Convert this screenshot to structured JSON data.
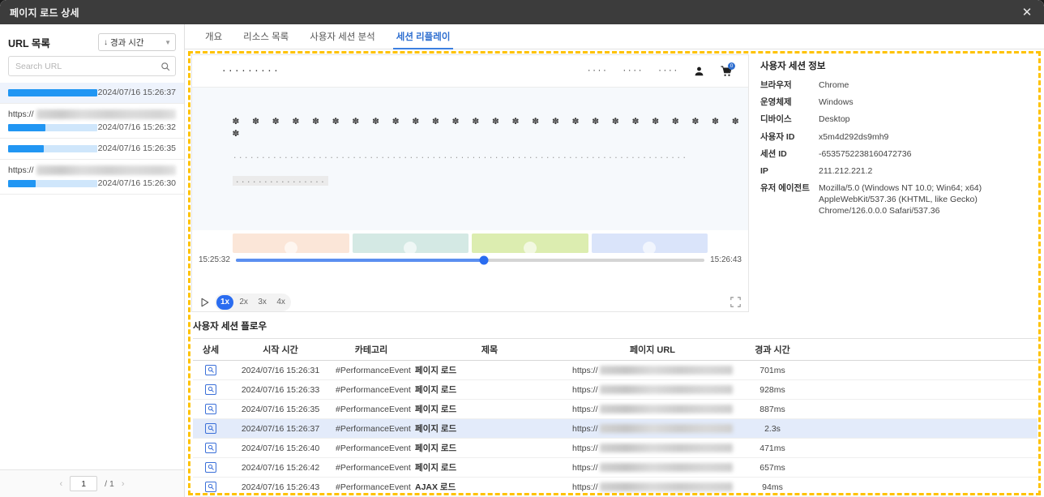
{
  "window": {
    "title": "페이지 로드 상세",
    "close_icon": "close-icon"
  },
  "sidebar": {
    "heading": "URL 목록",
    "sort": {
      "label": "경과 시간",
      "direction_icon": "arrow-down-icon",
      "chevron": "chevron-down-icon"
    },
    "search": {
      "value": "",
      "placeholder": "Search URL",
      "icon": "search-icon"
    },
    "items": [
      {
        "protocol": "",
        "timestamp": "2024/07/16 15:26:37",
        "bar_pct": 100,
        "selected": true
      },
      {
        "protocol": "https://",
        "timestamp": "2024/07/16 15:26:32",
        "bar_pct": 42,
        "selected": false
      },
      {
        "protocol": "",
        "timestamp": "2024/07/16 15:26:35",
        "bar_pct": 40,
        "selected": false
      },
      {
        "protocol": "https://",
        "timestamp": "2024/07/16 15:26:30",
        "bar_pct": 31,
        "selected": false
      }
    ],
    "pagination": {
      "prev_icon": "chevron-left-icon",
      "current": "1",
      "total": "/ 1",
      "next_icon": "chevron-right-icon"
    }
  },
  "tabs": [
    {
      "label": "개요",
      "active": false
    },
    {
      "label": "리소스 목록",
      "active": false
    },
    {
      "label": "사용자 세션 분석",
      "active": false
    },
    {
      "label": "세션 리플레이",
      "active": true
    }
  ],
  "player": {
    "site": {
      "logo_mask": "·········",
      "nav_masks": [
        "····",
        "····",
        "····"
      ],
      "account_icon": "person-icon",
      "cart_icon": "shopping-cart-icon",
      "cart_badge": "0",
      "heading_mask": "✽ ✽ ✽ ✽ ✽ ✽ ✽ ✽ ✽ ✽ ✽ ✽ ✽ ✽ ✽ ✽ ✽ ✽ ✽ ✽ ✽ ✽ ✽ ✽ ✽ ✽ ✽",
      "body_mask": "................................................................................................................",
      "chip_mask": "................"
    },
    "timeline": {
      "start_time": "15:25:32",
      "end_time": "15:26:43",
      "progress_pct": 53,
      "segments": [
        {
          "color": "#fbe6d8"
        },
        {
          "color": "#d4e9e4"
        },
        {
          "color": "#dcedb0"
        },
        {
          "color": "#dae4fa"
        }
      ]
    },
    "controls": {
      "play_icon": "play-icon",
      "speeds": [
        {
          "label": "1x",
          "active": true
        },
        {
          "label": "2x",
          "active": false
        },
        {
          "label": "3x",
          "active": false
        },
        {
          "label": "4x",
          "active": false
        }
      ],
      "fullscreen_icon": "fullscreen-icon"
    }
  },
  "session_info": {
    "title": "사용자 세션 정보",
    "rows": [
      {
        "key": "브라우저",
        "value": "Chrome"
      },
      {
        "key": "운영체제",
        "value": "Windows"
      },
      {
        "key": "디바이스",
        "value": "Desktop"
      },
      {
        "key": "사용자 ID",
        "value": "x5m4d292ds9mh9"
      },
      {
        "key": "세션 ID",
        "value": "-6535752238160472736"
      },
      {
        "key": "IP",
        "value": "211.212.221.2"
      },
      {
        "key": "유저 에이전트",
        "value": "Mozilla/5.0 (Windows NT 10.0; Win64; x64) AppleWebKit/537.36 (KHTML, like Gecko) Chrome/126.0.0.0 Safari/537.36"
      }
    ]
  },
  "flow": {
    "title": "사용자 세션 플로우",
    "columns": [
      "상세",
      "시작 시간",
      "카테고리",
      "제목",
      "페이지 URL",
      "경과 시간"
    ],
    "rows": [
      {
        "detail_icon": "magnify-detail-icon",
        "start": "2024/07/16 15:26:31",
        "category": "#PerformanceEvent",
        "title": "페이지 로드",
        "url_protocol": "https://",
        "duration": "701ms",
        "selected": false
      },
      {
        "detail_icon": "magnify-detail-icon",
        "start": "2024/07/16 15:26:33",
        "category": "#PerformanceEvent",
        "title": "페이지 로드",
        "url_protocol": "https://",
        "duration": "928ms",
        "selected": false
      },
      {
        "detail_icon": "magnify-detail-icon",
        "start": "2024/07/16 15:26:35",
        "category": "#PerformanceEvent",
        "title": "페이지 로드",
        "url_protocol": "https://",
        "duration": "887ms",
        "selected": false
      },
      {
        "detail_icon": "magnify-detail-icon",
        "start": "2024/07/16 15:26:37",
        "category": "#PerformanceEvent",
        "title": "페이지 로드",
        "url_protocol": "https://",
        "duration": "2.3s",
        "selected": true
      },
      {
        "detail_icon": "magnify-detail-icon",
        "start": "2024/07/16 15:26:40",
        "category": "#PerformanceEvent",
        "title": "페이지 로드",
        "url_protocol": "https://",
        "duration": "471ms",
        "selected": false
      },
      {
        "detail_icon": "magnify-detail-icon",
        "start": "2024/07/16 15:26:42",
        "category": "#PerformanceEvent",
        "title": "페이지 로드",
        "url_protocol": "https://",
        "duration": "657ms",
        "selected": false
      },
      {
        "detail_icon": "magnify-detail-icon",
        "start": "2024/07/16 15:26:43",
        "category": "#PerformanceEvent",
        "title": "AJAX 로드",
        "url_protocol": "https://",
        "duration": "94ms",
        "selected": false
      }
    ]
  },
  "colors": {
    "accent": "#2a6cf0",
    "highlight": "#FFC200",
    "titlebar": "#3c3c3c",
    "selected_row": "#e3ebfa"
  }
}
